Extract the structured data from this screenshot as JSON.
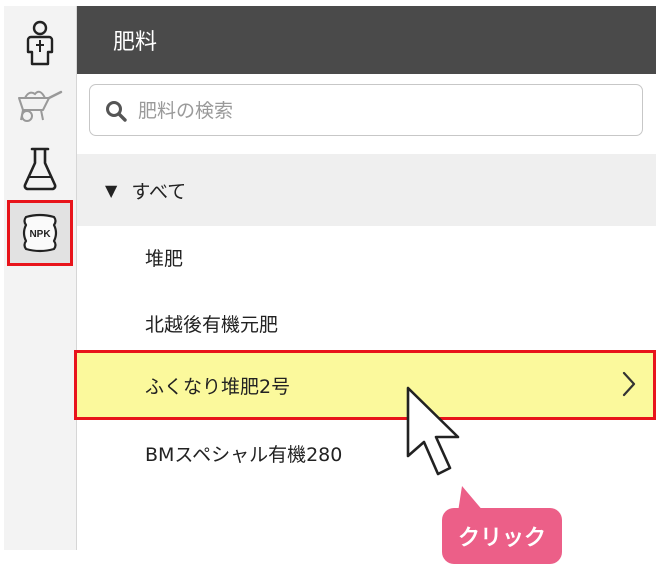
{
  "sidebar": {
    "items": [
      {
        "icon": "person-icon"
      },
      {
        "icon": "wheelbarrow-icon"
      },
      {
        "icon": "flask-icon"
      },
      {
        "icon": "npk-bag-icon",
        "label": "NPK",
        "active": true
      }
    ]
  },
  "panel": {
    "title": "肥料",
    "search": {
      "placeholder": "肥料の検索",
      "value": ""
    },
    "group": {
      "arrow": "▼",
      "label": "すべて"
    },
    "items": [
      {
        "label": "堆肥"
      },
      {
        "label": "北越後有機元肥"
      },
      {
        "label": "ふくなり堆肥2号",
        "selected": true
      },
      {
        "label": "BMスペシャル有機280"
      }
    ]
  },
  "annotation": {
    "label": "クリック"
  },
  "colors": {
    "header_bg": "#4a4a4a",
    "highlight_red": "#e8141b",
    "selected_bg": "#fbf99c",
    "badge_pink": "#ec5f88",
    "group_bg": "#efefef"
  }
}
